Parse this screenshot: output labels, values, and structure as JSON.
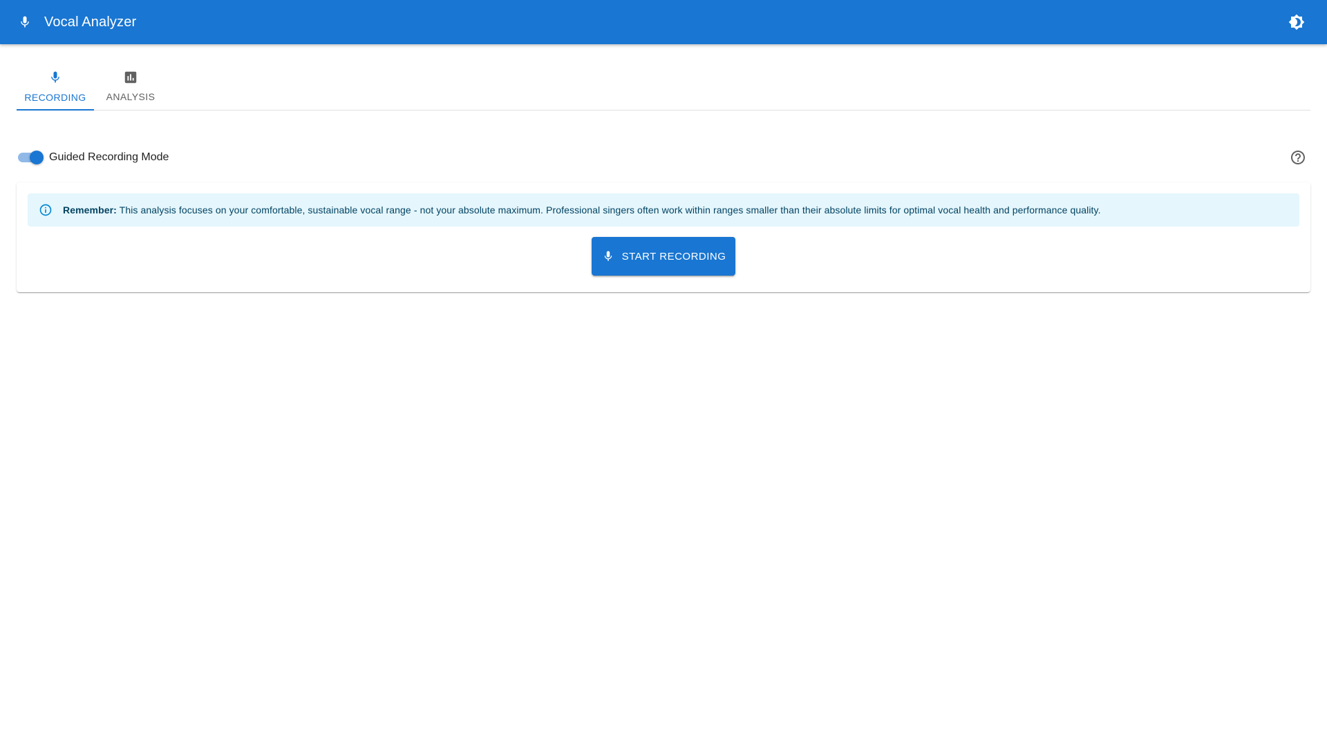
{
  "app": {
    "title": "Vocal Analyzer",
    "icons": {
      "logo": "microphone-icon",
      "theme": "brightness-icon"
    }
  },
  "tabs": [
    {
      "label": "RECORDING",
      "icon": "microphone-icon",
      "active": true
    },
    {
      "label": "ANALYSIS",
      "icon": "bar-chart-icon",
      "active": false
    }
  ],
  "guided_mode": {
    "label": "Guided Recording Mode",
    "enabled": true,
    "help_icon": "help-circle-icon"
  },
  "alert": {
    "icon": "info-icon",
    "bold": "Remember:",
    "text": " This analysis focuses on your comfortable, sustainable vocal range - not your absolute maximum. Professional singers often work within ranges smaller than their absolute limits for optimal vocal health and performance quality."
  },
  "start_button": {
    "label": "START RECORDING",
    "icon": "microphone-icon"
  },
  "colors": {
    "primary": "#1976d2",
    "alert_bg": "#e5f6fd",
    "alert_text": "#014361",
    "alert_icon": "#0288d1"
  }
}
